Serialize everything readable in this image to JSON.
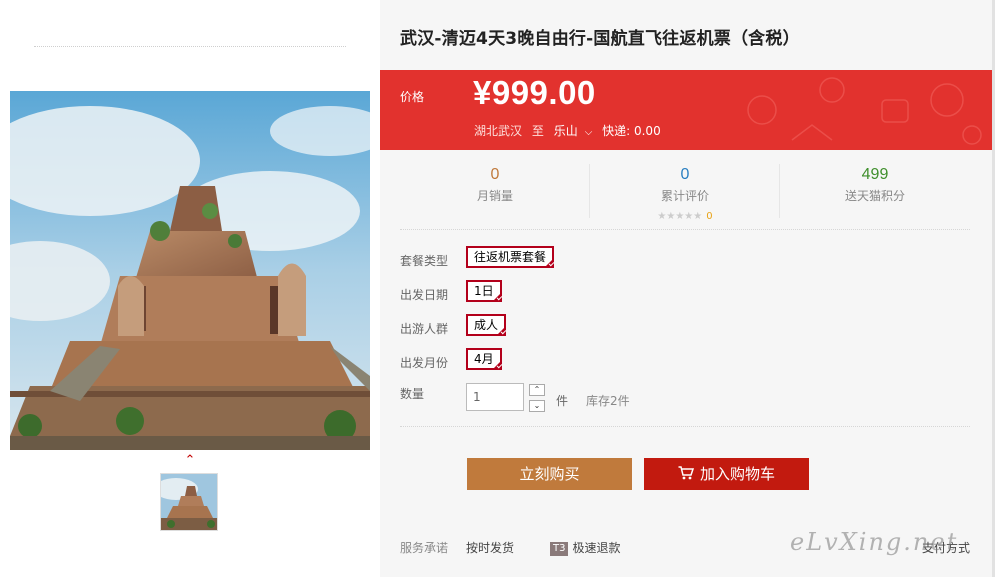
{
  "product": {
    "title": "武汉-清迈4天3晚自由行-国航直飞往返机票（含税）"
  },
  "price": {
    "label": "价格",
    "value": "¥999.00",
    "from": "湖北武汉",
    "to_word": "至",
    "to_city": "乐山",
    "express": "快递: 0.00"
  },
  "stats": {
    "monthly_sales": {
      "value": "0",
      "label": "月销量"
    },
    "reviews": {
      "value": "0",
      "label": "累计评价",
      "stars": "★★★★★",
      "star_count": "0"
    },
    "points": {
      "value": "499",
      "label": "送天猫积分"
    }
  },
  "options": {
    "package": {
      "label": "套餐类型",
      "selected": "往返机票套餐"
    },
    "date": {
      "label": "出发日期",
      "selected": "1日"
    },
    "crowd": {
      "label": "出游人群",
      "selected": "成人"
    },
    "month": {
      "label": "出发月份",
      "selected": "4月"
    }
  },
  "quantity": {
    "label": "数量",
    "value": "1",
    "unit": "件",
    "stock": "库存2件",
    "up_glyph": "⌃",
    "down_glyph": "⌄"
  },
  "actions": {
    "buy_now": "立刻购买",
    "add_to_cart": "加入购物车"
  },
  "service": {
    "label": "服务承诺",
    "item1": "按时发货",
    "badge": "T3",
    "item2": "极速退款",
    "item3": "支付方式"
  },
  "watermark": "eLvXing.net",
  "colors": {
    "price_bg": "#e2322e",
    "buy_btn": "#c07a3c",
    "cart_btn": "#c21a0f",
    "selected_border": "#b3001b"
  },
  "icons": {
    "thumb_nav": "chevron-up-icon",
    "cart": "shopping-cart-icon"
  }
}
